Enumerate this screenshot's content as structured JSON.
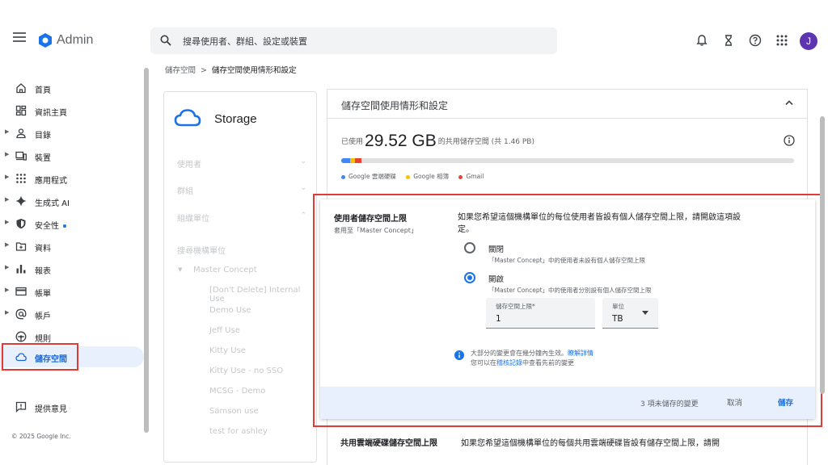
{
  "header": {
    "app_name": "Admin",
    "search_placeholder": "搜尋使用者、群組、設定或裝置",
    "avatar_letter": "J"
  },
  "breadcrumb": {
    "parent": "儲存空間",
    "separator": ">",
    "current": "儲存空間使用情形和設定"
  },
  "sidebar": {
    "items": [
      {
        "label": "首頁",
        "icon": "home-icon"
      },
      {
        "label": "資訊主頁",
        "icon": "dashboard-icon"
      },
      {
        "label": "目錄",
        "icon": "person-icon"
      },
      {
        "label": "裝置",
        "icon": "devices-icon"
      },
      {
        "label": "應用程式",
        "icon": "apps-grid-icon"
      },
      {
        "label": "生成式 AI",
        "icon": "sparkle-icon"
      },
      {
        "label": "安全性",
        "icon": "shield-icon"
      },
      {
        "label": "資料",
        "icon": "folder-icon"
      },
      {
        "label": "報表",
        "icon": "bar-chart-icon"
      },
      {
        "label": "帳單",
        "icon": "credit-card-icon"
      },
      {
        "label": "帳戶",
        "icon": "at-sign-icon"
      },
      {
        "label": "規則",
        "icon": "rules-icon"
      },
      {
        "label": "儲存空間",
        "icon": "cloud-icon"
      }
    ],
    "feedback": "提供意見",
    "copyright": "© 2025 Google Inc."
  },
  "storage_panel": {
    "title": "Storage",
    "filters": [
      "使用者",
      "群組",
      "組織單位"
    ],
    "search_org": "搜尋機構單位",
    "root_org": "Master Concept",
    "org_units": [
      "[Don't Delete] Internal Use",
      "Demo Use",
      "Jeff Use",
      "Kitty Use",
      "Kitty Use - no SSO",
      "MCSG - Demo",
      "Samson use",
      "test for ashley"
    ]
  },
  "main": {
    "section_title": "儲存空間使用情形和設定",
    "usage_prefix": "已使用",
    "usage_amount": "29.52 GB",
    "usage_suffix": "的共用儲存空間 (共 1.46 PB)",
    "legend": [
      {
        "label": "Google 雲端硬碟",
        "color": "#4285f4"
      },
      {
        "label": "Google 相簿",
        "color": "#fbbc04"
      },
      {
        "label": "Gmail",
        "color": "#ea4335"
      }
    ]
  },
  "settings": {
    "title": "使用者儲存空間上限",
    "applies_to": "套用至「Master Concept」",
    "description": "如果您希望這個機構單位的每位使用者皆設有個人儲存空間上限，請開啟這項設定。",
    "off_label": "關閉",
    "off_desc": "「Master Concept」中的使用者未設有個人儲存空間上限",
    "on_label": "開啟",
    "on_desc": "「Master Concept」中的使用者分別設有個人儲存空間上限",
    "limit_label": "儲存空間上限*",
    "limit_value": "1",
    "unit_label": "單位",
    "unit_value": "TB",
    "note_line1_text": "大部分的變更會在幾分鐘內生效。",
    "note_line1_link": "瞭解詳情",
    "note_line2_prefix": "您可以在",
    "note_line2_link": "稽核記錄",
    "note_line2_suffix": "中查看先前的變更",
    "unsaved": "3 項未儲存的變更",
    "cancel": "取消",
    "save": "儲存"
  },
  "next_section": {
    "title": "共用雲端硬碟儲存空間上限",
    "description": "如果您希望這個機構單位的每個共用雲端硬碟皆設有儲存空間上限，請開"
  }
}
